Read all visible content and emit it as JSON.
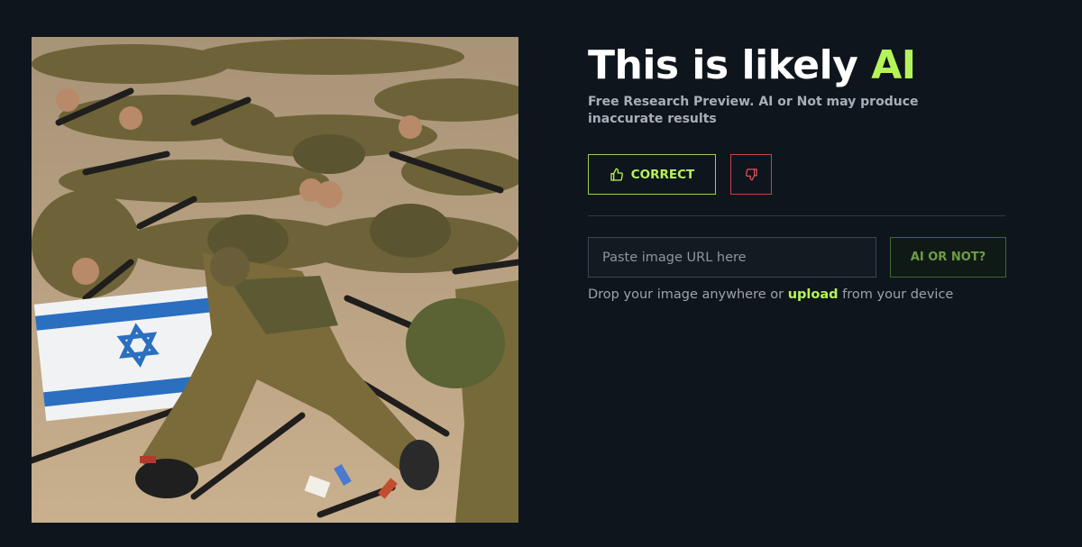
{
  "result": {
    "title_prefix": "This is likely ",
    "title_verdict": "AI",
    "disclaimer": "Free Research Preview. AI or Not may produce inaccurate results"
  },
  "feedback": {
    "correct_label": "CORRECT",
    "correct_icon": "thumbs-up-icon",
    "incorrect_icon": "thumbs-down-icon"
  },
  "checker": {
    "url_placeholder": "Paste image URL here",
    "submit_label": "AI OR NOT?",
    "hint_before": "Drop your image anywhere or ",
    "hint_link": "upload",
    "hint_after": " from your device"
  },
  "colors": {
    "background": "#0f151c",
    "accent_green": "#b5f35b",
    "danger_red": "#c8414b"
  }
}
